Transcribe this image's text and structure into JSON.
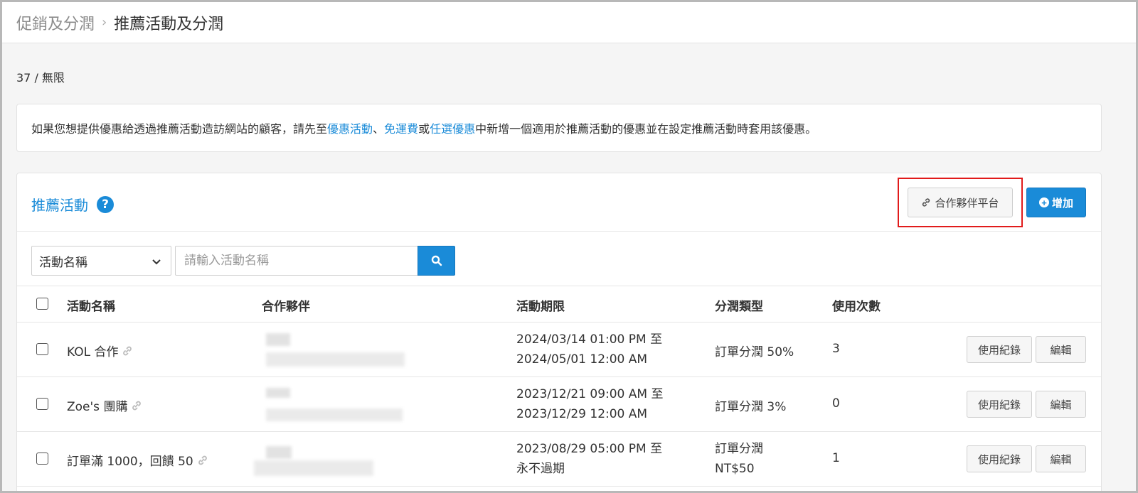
{
  "breadcrumb": {
    "parent": "促銷及分潤",
    "separator": "›",
    "current": "推薦活動及分潤"
  },
  "quota": "37 / 無限",
  "notice": {
    "prefix": "如果您想提供優惠給透過推薦活動造訪網站的顧客，請先至",
    "link1": "優惠活動",
    "sep1": "、",
    "link2": "免運費",
    "sep2": "或",
    "link3": "任選優惠",
    "suffix": "中新增一個適用於推薦活動的優惠並在設定推薦活動時套用該優惠。"
  },
  "panel": {
    "title": "推薦活動",
    "help": "?",
    "partner_button": "合作夥伴平台",
    "add_button": "增加"
  },
  "search": {
    "field_selected": "活動名稱",
    "placeholder": "請輸入活動名稱"
  },
  "table": {
    "headers": {
      "name": "活動名稱",
      "partner": "合作夥伴",
      "period": "活動期限",
      "type": "分潤類型",
      "usage": "使用次數"
    },
    "rows": [
      {
        "name": "KOL 合作",
        "period_start": "2024/03/14 01:00 PM 至",
        "period_end": "2024/05/01 12:00 AM",
        "type_line1": "訂單分潤 50%",
        "type_line2": "",
        "usage": "3",
        "log_button": "使用紀錄",
        "edit_button": "編輯"
      },
      {
        "name": "Zoe's 團購",
        "period_start": "2023/12/21 09:00 AM 至",
        "period_end": "2023/12/29 12:00 AM",
        "type_line1": "訂單分潤 3%",
        "type_line2": "",
        "usage": "0",
        "log_button": "使用紀錄",
        "edit_button": "編輯"
      },
      {
        "name": "訂單滿 1000，回饋 50",
        "period_start": "2023/08/29 05:00 PM 至",
        "period_end": "永不過期",
        "type_line1": "訂單分潤",
        "type_line2": "NT$50",
        "usage": "1",
        "log_button": "使用紀錄",
        "edit_button": "編輯"
      }
    ]
  },
  "colors": {
    "accent": "#1a8bd8",
    "highlight": "#e11b1b"
  }
}
